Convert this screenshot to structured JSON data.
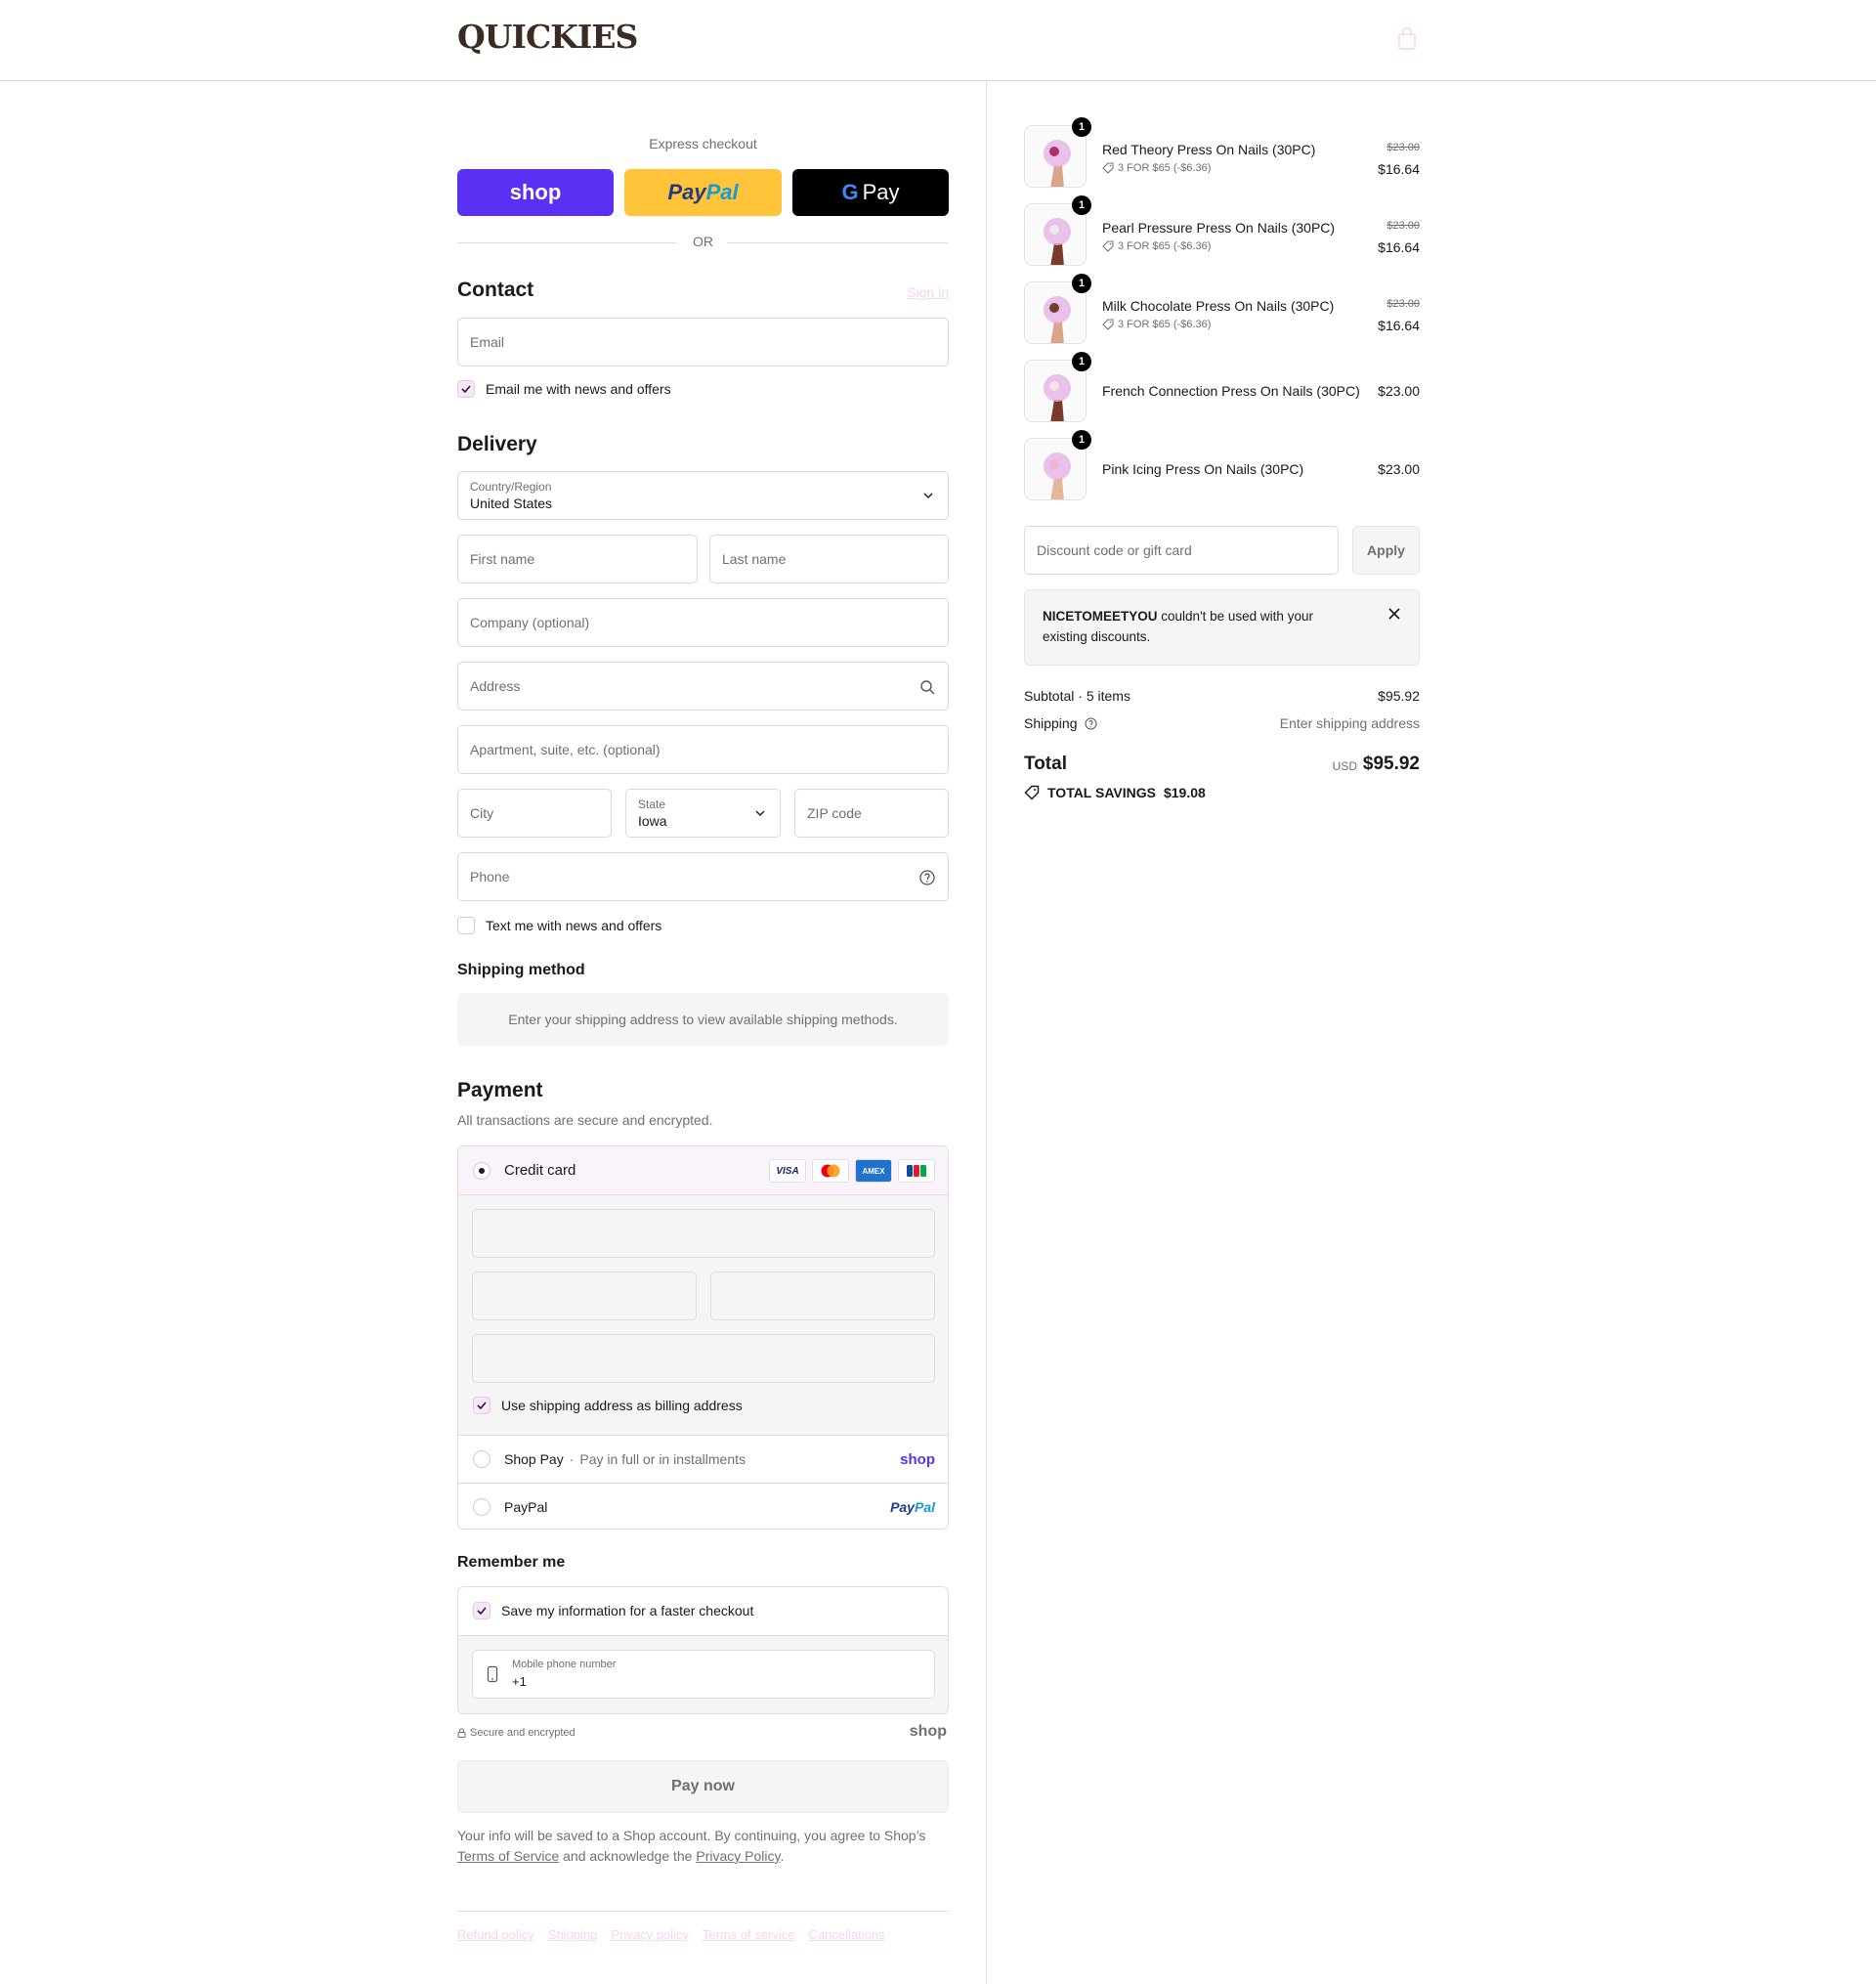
{
  "header": {
    "logo": "QUICKIES"
  },
  "express": {
    "title": "Express checkout",
    "shop_label": "shop",
    "paypal_pay": "Pay",
    "paypal_pal": "Pal",
    "gpay_g": "G",
    "gpay_label": "Pay",
    "or_label": "OR"
  },
  "contact": {
    "title": "Contact",
    "signin_label": "Sign in",
    "email_placeholder": "Email",
    "news_label": "Email me with news and offers"
  },
  "delivery": {
    "title": "Delivery",
    "country_label": "Country/Region",
    "country_value": "United States",
    "first_name_placeholder": "First name",
    "last_name_placeholder": "Last name",
    "company_placeholder": "Company (optional)",
    "address_placeholder": "Address",
    "apartment_placeholder": "Apartment, suite, etc. (optional)",
    "city_placeholder": "City",
    "state_label": "State",
    "state_value": "Iowa",
    "zip_placeholder": "ZIP code",
    "phone_placeholder": "Phone",
    "text_label": "Text me with news and offers"
  },
  "shipping_method": {
    "title": "Shipping method",
    "message": "Enter your shipping address to view available shipping methods."
  },
  "payment": {
    "title": "Payment",
    "subtitle": "All transactions are secure and encrypted.",
    "credit_card_label": "Credit card",
    "card_brands": [
      "VISA",
      "MC",
      "AMEX",
      "JCB"
    ],
    "billing_label": "Use shipping address as billing address",
    "shop_pay_label": "Shop Pay",
    "shop_pay_sep": "·",
    "shop_pay_sub": "Pay in full or in installments",
    "shop_pay_logo": "shop",
    "paypal_label": "PayPal",
    "paypal_logo_pay": "Pay",
    "paypal_logo_pal": "Pal"
  },
  "remember": {
    "title": "Remember me",
    "save_label": "Save my information for a faster checkout",
    "mobile_label": "Mobile phone number",
    "mobile_value": "+1"
  },
  "footer": {
    "secure_label": "Secure and encrypted",
    "shop_label": "shop",
    "pay_now": "Pay now",
    "legal_prefix": "Your info will be saved to a Shop account. By continuing, you agree to Shop’s",
    "terms_link": "Terms of Service",
    "legal_mid": "and acknowledge the",
    "privacy_link": "Privacy Policy",
    "legal_end": ".",
    "links": [
      "Refund policy",
      "Shipping",
      "Privacy policy",
      "Terms of service",
      "Cancellations"
    ]
  },
  "cart": {
    "items": [
      {
        "qty": "1",
        "name": "Red Theory Press On Nails (30PC)",
        "discount": "3 FOR $65 (-$6.36)",
        "old_price": "$23.00",
        "price": "$16.64"
      },
      {
        "qty": "1",
        "name": "Pearl Pressure Press On Nails (30PC)",
        "discount": "3 FOR $65 (-$6.36)",
        "old_price": "$23.00",
        "price": "$16.64"
      },
      {
        "qty": "1",
        "name": "Milk Chocolate Press On Nails (30PC)",
        "discount": "3 FOR $65 (-$6.36)",
        "old_price": "$23.00",
        "price": "$16.64"
      },
      {
        "qty": "1",
        "name": "French Connection Press On Nails (30PC)",
        "price": "$23.00"
      },
      {
        "qty": "1",
        "name": "Pink Icing Press On Nails (30PC)",
        "price": "$23.00"
      }
    ],
    "discount_placeholder": "Discount code or gift card",
    "apply_label": "Apply",
    "notice_code": "NICETOMEETYOU",
    "notice_text": "couldn't be used with your existing discounts.",
    "subtotal_label": "Subtotal · 5 items",
    "subtotal_value": "$95.92",
    "shipping_label": "Shipping",
    "shipping_value": "Enter shipping address",
    "total_label": "Total",
    "total_currency": "USD",
    "total_value": "$95.92",
    "savings_label": "TOTAL SAVINGS",
    "savings_value": "$19.08"
  },
  "colors": {
    "shop_purple": "#5a31f4",
    "paypal_yellow": "#ffc439",
    "accent_pink": "#f6e9f6"
  }
}
